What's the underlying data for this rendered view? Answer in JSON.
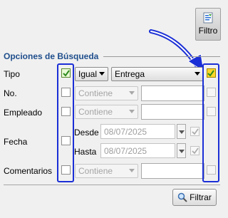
{
  "toolbar": {
    "filtro_label": "Filtro",
    "filtro_icon": "filter-icon"
  },
  "group": {
    "title": "Opciones de Búsqueda"
  },
  "rows": {
    "tipo": {
      "label": "Tipo",
      "operator": "Igual",
      "value": "Entrega"
    },
    "no": {
      "label": "No.",
      "operator": "Contiene"
    },
    "empleado": {
      "label": "Empleado",
      "operator": "Contiene"
    },
    "fecha": {
      "label": "Fecha",
      "desde_label": "Desde",
      "desde_value": "08/07/2025",
      "hasta_label": "Hasta",
      "hasta_value": "08/07/2025"
    },
    "comentarios": {
      "label": "Comentarios",
      "operator": "Contiene"
    }
  },
  "actions": {
    "filtrar_label": "Filtrar",
    "filtrar_icon": "magnifier-icon"
  },
  "colors": {
    "highlight": "#1b2fd6",
    "title": "#1f4e8c",
    "checked_yellow": "#ffd82a",
    "checked_green": "#eafbd8"
  }
}
